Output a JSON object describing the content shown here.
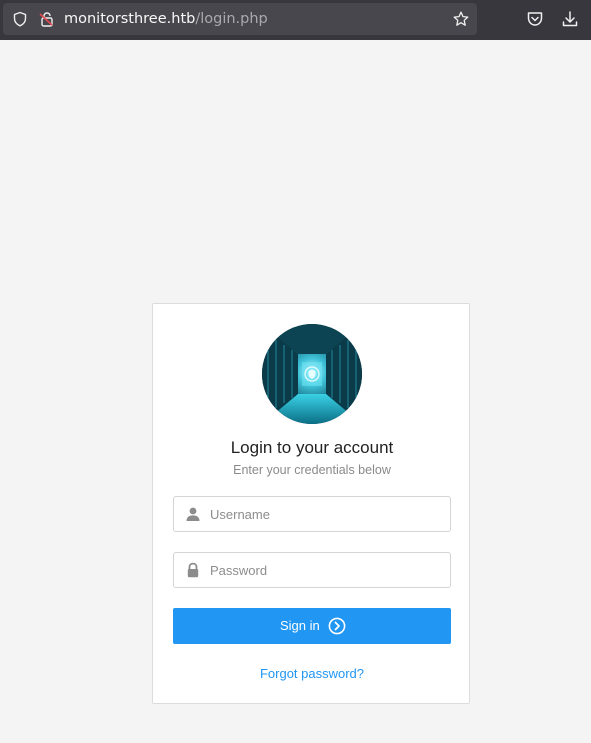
{
  "browser": {
    "url_domain": "monitorsthree.htb",
    "url_path": "/login.php",
    "icons": [
      "shield-icon",
      "lock-icon",
      "bookmark-star-icon",
      "pocket-icon",
      "download-icon"
    ]
  },
  "login": {
    "title": "Login to your account",
    "subtitle": "Enter your credentials below",
    "username_placeholder": "Username",
    "password_placeholder": "Password",
    "signin_label": "Sign in",
    "forgot_label": "Forgot password?",
    "accent_color": "#2196f3"
  }
}
